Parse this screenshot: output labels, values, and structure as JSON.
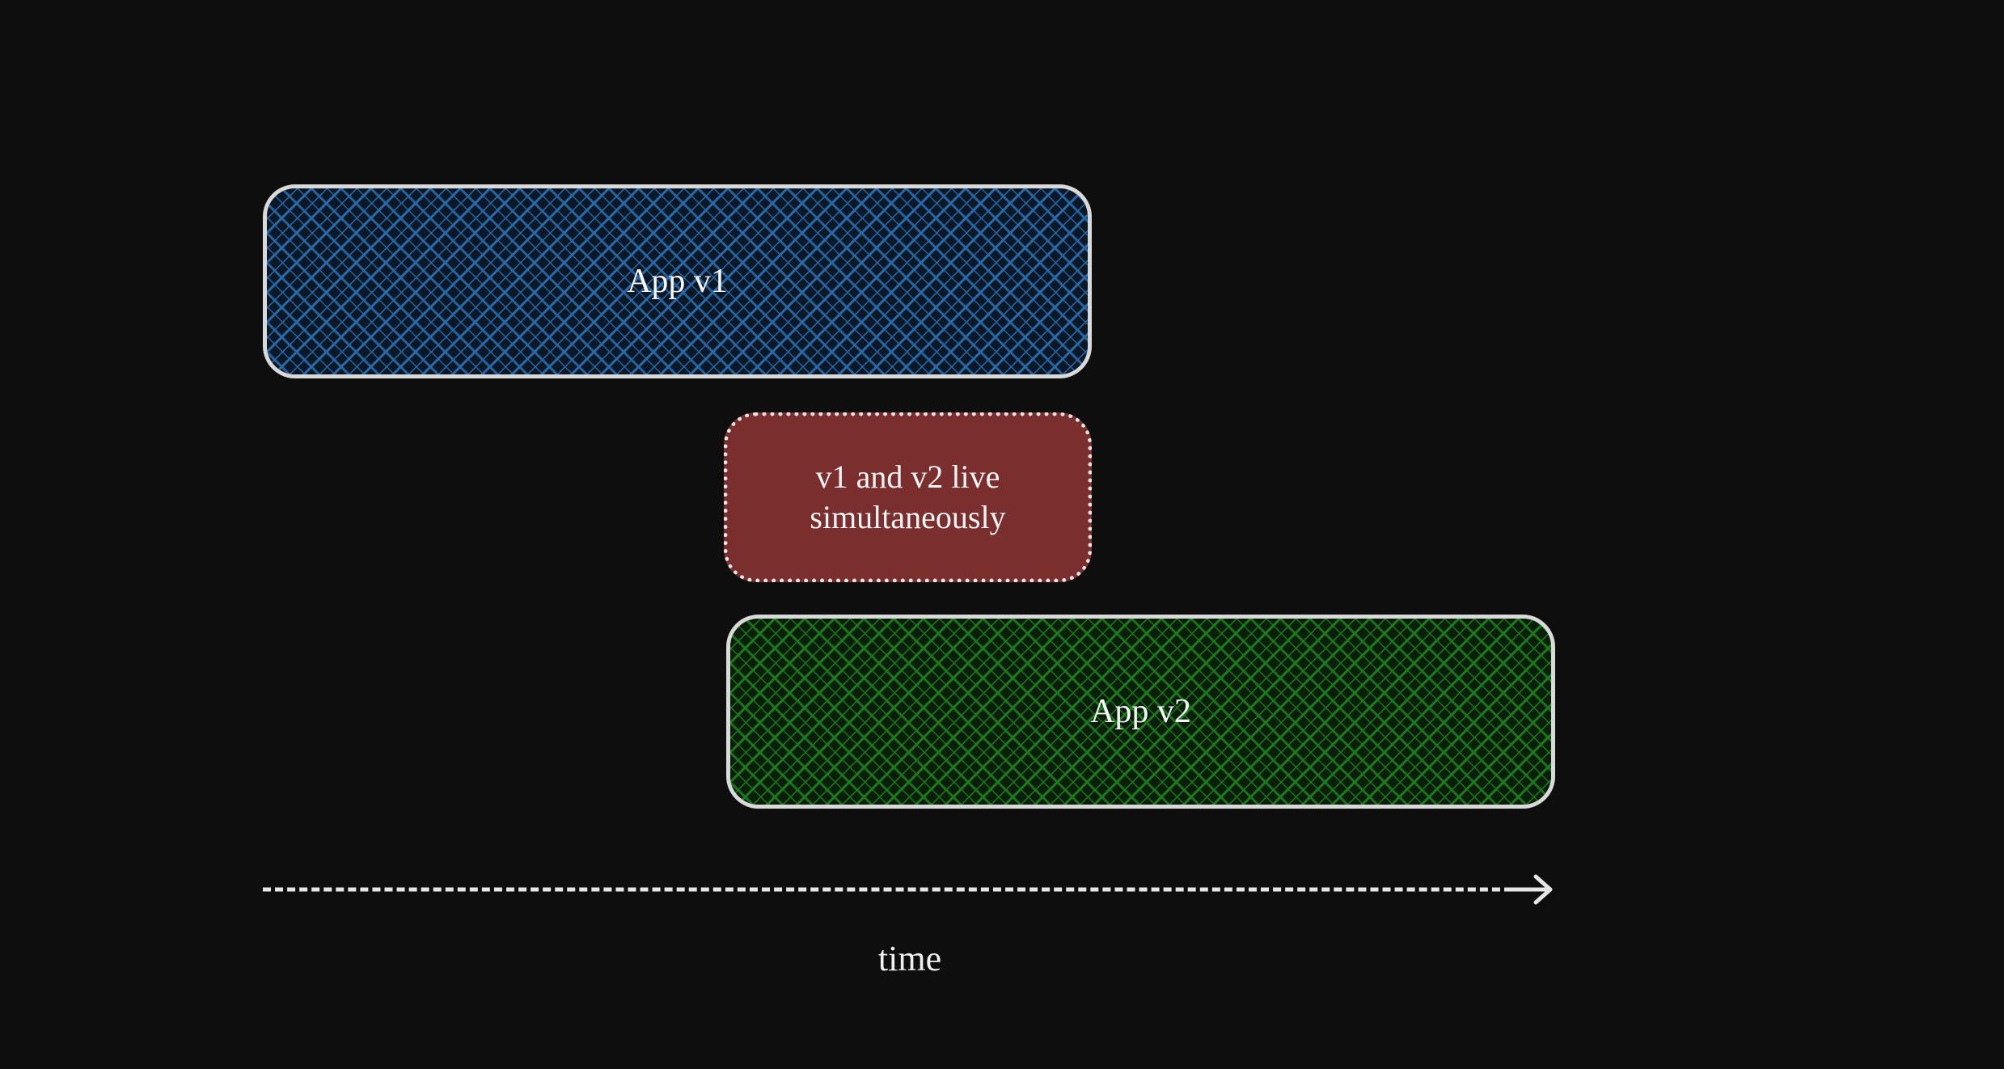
{
  "diagram": {
    "boxes": {
      "app_v1": {
        "label": "App v1"
      },
      "overlap": {
        "label": "v1 and v2 live\nsimultaneously"
      },
      "app_v2": {
        "label": "App v2"
      }
    },
    "timeline": {
      "label": "time"
    },
    "colors": {
      "background": "#0e0e0e",
      "box_border": "#d9d9d9",
      "hatch_blue": "#1f4f7a",
      "hatch_green": "#1f6b1f",
      "maroon": "#7a2e2e",
      "text": "#f0f0f0"
    }
  }
}
